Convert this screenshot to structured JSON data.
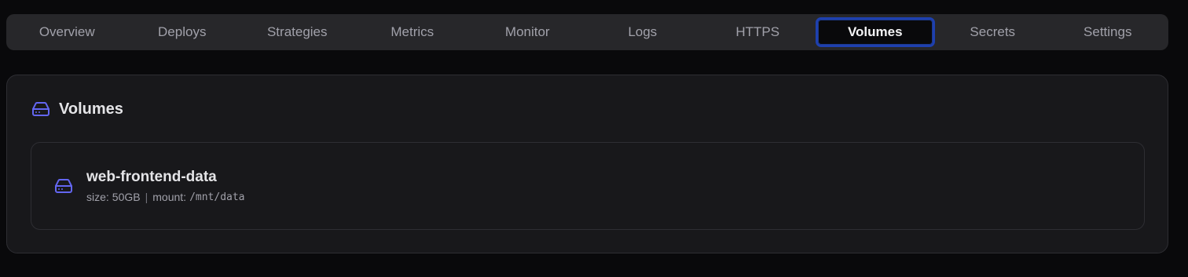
{
  "tabs": [
    {
      "label": "Overview"
    },
    {
      "label": "Deploys"
    },
    {
      "label": "Strategies"
    },
    {
      "label": "Metrics"
    },
    {
      "label": "Monitor"
    },
    {
      "label": "Logs"
    },
    {
      "label": "HTTPS"
    },
    {
      "label": "Volumes",
      "active": true
    },
    {
      "label": "Secrets"
    },
    {
      "label": "Settings"
    }
  ],
  "section": {
    "title": "Volumes",
    "icon": "hard-drive-icon"
  },
  "volumes": [
    {
      "name": "web-frontend-data",
      "size_label": "size:",
      "size": "50GB",
      "separator": "|",
      "mount_label": "mount:",
      "mount": "/mnt/data",
      "icon": "hard-drive-icon"
    }
  ],
  "colors": {
    "accent_icon": "#6366f1",
    "active_tab_border": "#1e40af"
  }
}
